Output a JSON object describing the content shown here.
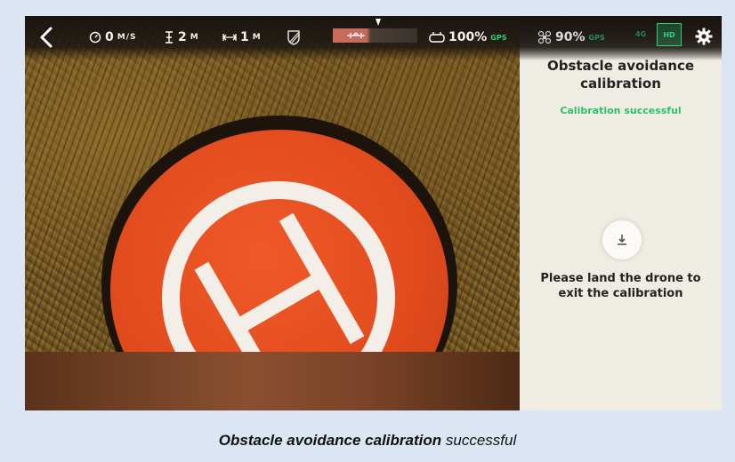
{
  "topbar": {
    "speed_value": "0",
    "speed_unit": "M/S",
    "height_value": "2",
    "height_unit": "M",
    "distance_value": "1",
    "distance_unit": "M",
    "controller_battery": "100%",
    "gps_label": "GPS",
    "drone_battery": "90%",
    "drone_gps_label": "GPS",
    "signal_label": "4G",
    "hd_label": "HD"
  },
  "panel": {
    "title_line1": "Obstacle avoidance",
    "title_line2": "calibration",
    "status": "Calibration successful",
    "message_line1": "Please land the drone to",
    "message_line2": "exit the calibration"
  },
  "caption": {
    "bold": "Obstacle avoidance calibration",
    "rest": " successful"
  },
  "colors": {
    "success": "#2fbf6a",
    "panel_bg": "#efece4",
    "page_bg": "#dbe5f3"
  },
  "icons": {
    "back": "back-chevron-icon",
    "speed": "speedometer-icon",
    "height": "altitude-icon",
    "distance": "distance-icon",
    "obstacle": "obstacle-off-icon",
    "controller": "controller-icon",
    "drone": "drone-icon",
    "settings": "gear-icon",
    "land": "land-icon"
  }
}
